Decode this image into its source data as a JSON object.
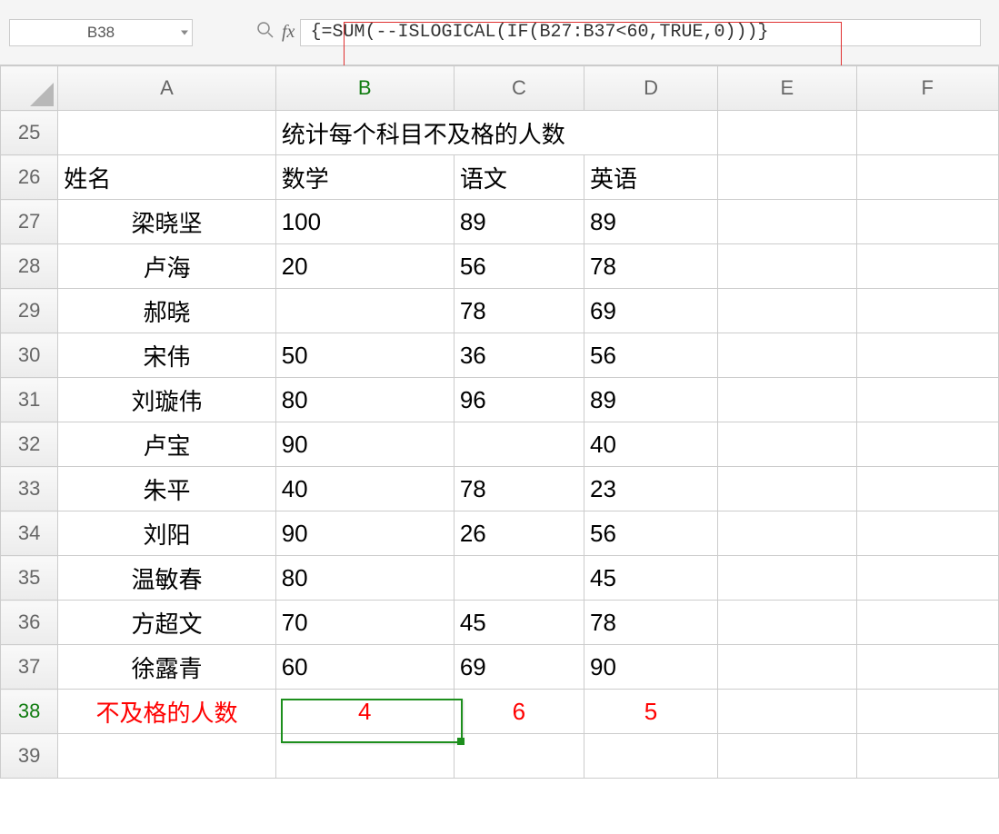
{
  "nameBox": "B38",
  "formula": "{=SUM(--ISLOGICAL(IF(B27:B37<60,TRUE,0)))}",
  "columns": [
    "A",
    "B",
    "C",
    "D",
    "E",
    "F"
  ],
  "rowNumbers": [
    "25",
    "26",
    "27",
    "28",
    "29",
    "30",
    "31",
    "32",
    "33",
    "34",
    "35",
    "36",
    "37",
    "38",
    "39"
  ],
  "rows": {
    "25": {
      "A": "",
      "B_merged": "统计每个科目不及格的人数",
      "E": "",
      "F": ""
    },
    "26": {
      "A": "姓名",
      "B": "数学",
      "C": "语文",
      "D": "英语",
      "E": "",
      "F": ""
    },
    "27": {
      "A": "梁晓坚",
      "B": "100",
      "C": "89",
      "D": "89",
      "E": "",
      "F": ""
    },
    "28": {
      "A": "卢海",
      "B": "20",
      "C": "56",
      "D": "78",
      "E": "",
      "F": ""
    },
    "29": {
      "A": "郝晓",
      "B": "",
      "C": "78",
      "D": "69",
      "E": "",
      "F": ""
    },
    "30": {
      "A": "宋伟",
      "B": "50",
      "C": "36",
      "D": "56",
      "E": "",
      "F": ""
    },
    "31": {
      "A": "刘璇伟",
      "B": "80",
      "C": "96",
      "D": "89",
      "E": "",
      "F": ""
    },
    "32": {
      "A": "卢宝",
      "B": "90",
      "C": "",
      "D": "40",
      "E": "",
      "F": ""
    },
    "33": {
      "A": "朱平",
      "B": "40",
      "C": "78",
      "D": "23",
      "E": "",
      "F": ""
    },
    "34": {
      "A": "刘阳",
      "B": "90",
      "C": "26",
      "D": "56",
      "E": "",
      "F": ""
    },
    "35": {
      "A": "温敏春",
      "B": "80",
      "C": "",
      "D": "45",
      "E": "",
      "F": ""
    },
    "36": {
      "A": "方超文",
      "B": "70",
      "C": "45",
      "D": "78",
      "E": "",
      "F": ""
    },
    "37": {
      "A": "徐露青",
      "B": "60",
      "C": "69",
      "D": "90",
      "E": "",
      "F": ""
    },
    "38": {
      "A": "不及格的人数",
      "B": "4",
      "C": "6",
      "D": "5",
      "E": "",
      "F": ""
    },
    "39": {
      "A": "",
      "B": "",
      "C": "",
      "D": "",
      "E": "",
      "F": ""
    }
  }
}
